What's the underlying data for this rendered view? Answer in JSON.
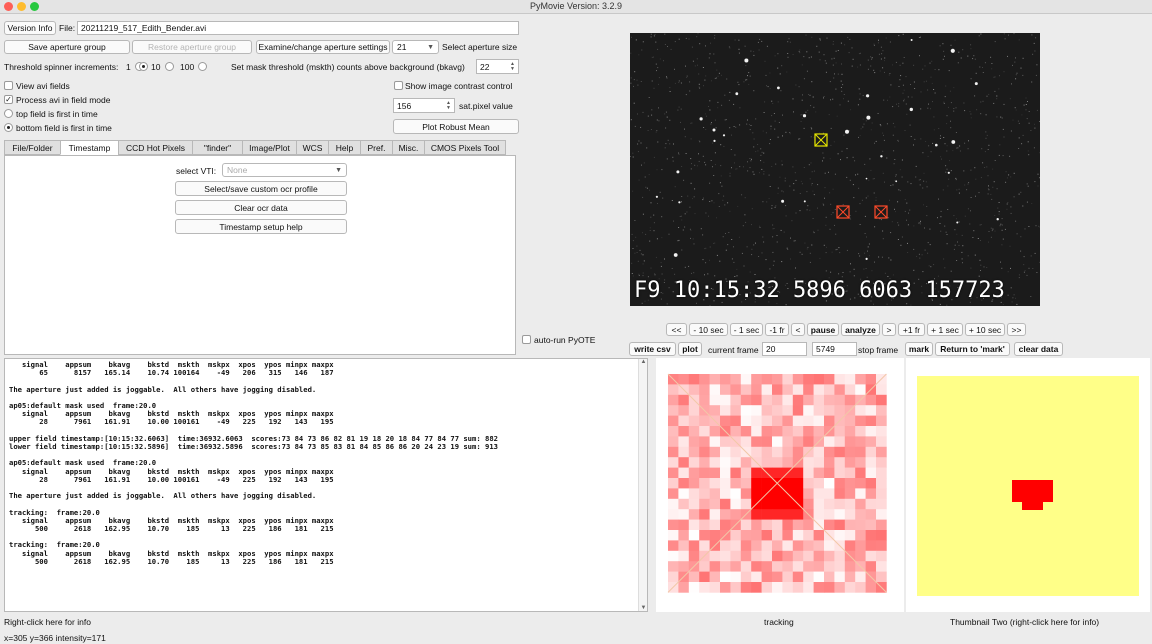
{
  "window": {
    "title": "PyMovie  Version: 3.2.9"
  },
  "top": {
    "version_info": "Version Info",
    "file_label": "File:",
    "file_value": "20211219_517_Edith_Bender.avi",
    "save_aperture_group": "Save aperture group",
    "restore_aperture_group": "Restore aperture group",
    "examine_aperture_settings": "Examine/change aperture settings",
    "aperture_size_value": "21",
    "select_aperture_size": "Select aperture size",
    "threshold_label": "Threshold spinner increments:",
    "threshold_options": [
      "1",
      "10",
      "100"
    ],
    "threshold_selected": "10",
    "mask_threshold_label": "Set mask threshold (mskth) counts above background (bkavg)",
    "mask_threshold_value": "22"
  },
  "options": {
    "view_avi_fields": "View avi fields",
    "process_avi_field_mode": "Process avi in field mode",
    "top_field_first": "top field is first in time",
    "bottom_field_first": "bottom field is first in time",
    "show_image_contrast": "Show image contrast control",
    "sat_pixel_value": "156",
    "sat_pixel_label": "sat.pixel value",
    "plot_robust_mean": "Plot Robust Mean"
  },
  "tabs": [
    {
      "label": "File/Folder"
    },
    {
      "label": "Timestamp"
    },
    {
      "label": "CCD Hot Pixels"
    },
    {
      "label": "\"finder\""
    },
    {
      "label": "Image/Plot"
    },
    {
      "label": "WCS"
    },
    {
      "label": "Help"
    },
    {
      "label": "Pref."
    },
    {
      "label": "Misc."
    },
    {
      "label": "CMOS Pixels Tool"
    }
  ],
  "timestamp_tab": {
    "select_vti_label": "select VTI:",
    "select_vti_value": "None",
    "custom_ocr_profile": "Select/save custom ocr profile",
    "clear_ocr_data": "Clear ocr data",
    "timestamp_setup_help": "Timestamp setup help"
  },
  "video": {
    "timestamp_overlay": "F9 10:15:32 5896 6063 157723"
  },
  "controls": {
    "auto_run_pyote": "auto-run PyOTE",
    "nav_buttons": [
      "<<",
      "- 10 sec",
      "- 1 sec",
      "-1 fr",
      "<",
      "pause",
      "analyze",
      ">",
      "+1 fr",
      "+ 1 sec",
      "+ 10 sec",
      ">>"
    ],
    "write_csv": "write csv",
    "plot": "plot",
    "current_frame_label": "current frame",
    "current_frame_value": "20",
    "stop_frame_value": "5749",
    "stop_frame_label": "stop frame",
    "mark": "mark",
    "return_to_mark": "Return to 'mark'",
    "clear_data": "clear data"
  },
  "log_text": "   signal    appsum    bkavg    bkstd  mskth  mskpx  xpos  ypos minpx maxpx\n       65      8157   165.14    10.74 100164    -49   206   315   146   187\n\nThe aperture just added is joggable.  All others have jogging disabled.\n\nap05:default mask used  frame:20.0\n   signal    appsum    bkavg    bkstd  mskth  mskpx  xpos  ypos minpx maxpx\n       28      7961   161.91    10.00 100161    -49   225   192   143   195\n\nupper field timestamp:[10:15:32.6063]  time:36932.6063  scores:73 84 73 86 82 81 19 18 20 18 84 77 84 77 sum: 882\nlower field timestamp:[10:15:32.5896]  time:36932.5896  scores:73 84 73 85 83 81 84 85 86 86 20 24 23 19 sum: 913\n\nap05:default mask used  frame:20.0\n   signal    appsum    bkavg    bkstd  mskth  mskpx  xpos  ypos minpx maxpx\n       28      7961   161.91    10.00 100161    -49   225   192   143   195\n\nThe aperture just added is joggable.  All others have jogging disabled.\n\ntracking:  frame:20.0\n   signal    appsum    bkavg    bkstd  mskth  mskpx  xpos  ypos minpx maxpx\n      500      2618   162.95    10.70    185     13   225   186   181   215\n\ntracking:  frame:20.0\n   signal    appsum    bkavg    bkstd  mskth  mskpx  xpos  ypos minpx maxpx\n      500      2618   162.95    10.70    185     13   225   186   181   215",
  "status": {
    "left": "Right-click here for info",
    "tracking": "tracking",
    "thumbnail_two": "Thumbnail Two (right-click here for info)",
    "cursor_readout": "x=305 y=366 intensity=171"
  },
  "colors": {
    "thumbnail_bg": "#ffff88",
    "mask_red": "#ff0000",
    "aperture_yellow": "#e8e800",
    "aperture_red": "#ff4a2a"
  }
}
